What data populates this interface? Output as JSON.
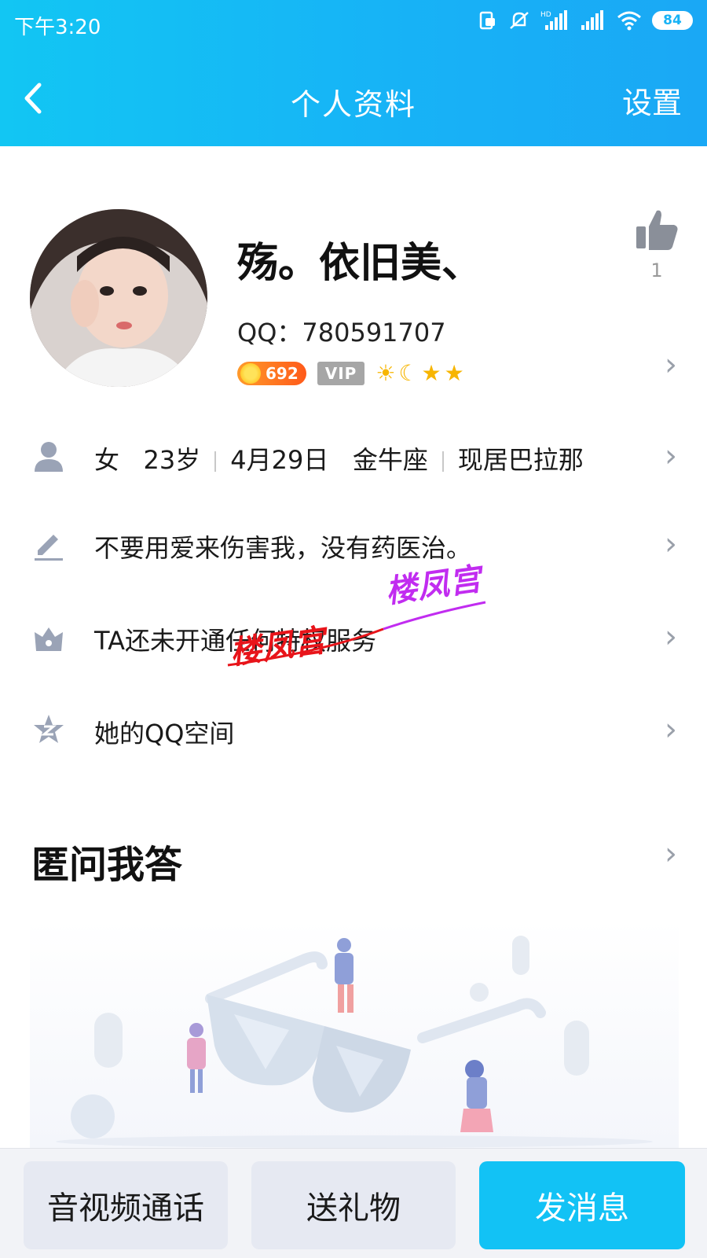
{
  "status_bar": {
    "time": "下午3:20",
    "battery": "84"
  },
  "nav": {
    "title": "个人资料",
    "settings_label": "设置"
  },
  "profile": {
    "nickname": "殇。依旧美、",
    "qq_line": "QQ：780591707",
    "coin_value": "692",
    "vip_label": "VIP",
    "like_count": "1"
  },
  "info": {
    "gender": "女",
    "age": "23岁",
    "birthday": "4月29日",
    "zodiac": "金牛座",
    "location": "现居巴拉那",
    "signature": "不要用爱来伤害我，没有药医治。",
    "privilege": "TA还未开通任何特权服务",
    "qzone": "她的QQ空间"
  },
  "qa": {
    "title": "匿问我答"
  },
  "watermark": {
    "text_red": "楼凤宫",
    "text_purple": "楼凤宫"
  },
  "bottom_bar": {
    "av_call": "音视频通话",
    "gift": "送礼物",
    "message": "发消息"
  },
  "colors": {
    "header": "#17b3f6",
    "primary_button": "#12c2f5",
    "icon_gray": "#9aa3b6"
  },
  "icons": [
    "back-arrow-icon",
    "person-icon",
    "pencil-icon",
    "crown-icon",
    "qzone-star-icon",
    "thumbs-up-icon",
    "chevron-right-icon"
  ]
}
